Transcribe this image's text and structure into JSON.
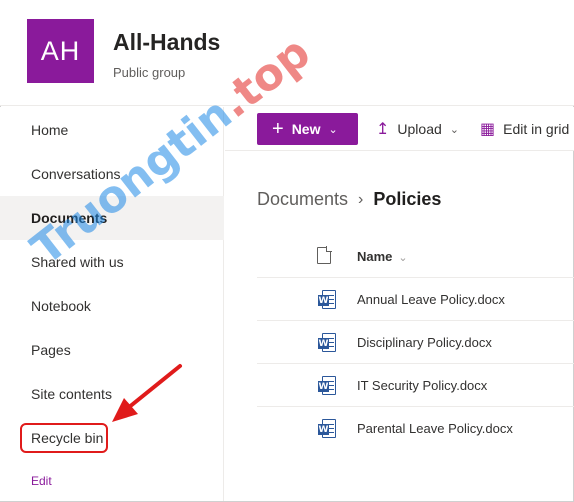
{
  "site": {
    "logo_initials": "AH",
    "title": "All-Hands",
    "subtitle": "Public group"
  },
  "nav": {
    "items": [
      {
        "label": "Home"
      },
      {
        "label": "Conversations"
      },
      {
        "label": "Documents",
        "selected": true
      },
      {
        "label": "Shared with us"
      },
      {
        "label": "Notebook"
      },
      {
        "label": "Pages"
      },
      {
        "label": "Site contents"
      },
      {
        "label": "Recycle bin",
        "highlighted": true
      }
    ],
    "edit_label": "Edit"
  },
  "commandbar": {
    "new_label": "New",
    "upload_label": "Upload",
    "edit_grid_label": "Edit in grid"
  },
  "breadcrumb": {
    "parent": "Documents",
    "current": "Policies"
  },
  "list": {
    "column_name": "Name",
    "rows": [
      {
        "name": "Annual Leave Policy.docx"
      },
      {
        "name": "Disciplinary Policy.docx"
      },
      {
        "name": "IT Security Policy.docx"
      },
      {
        "name": "Parental Leave Policy.docx"
      }
    ]
  },
  "watermark": {
    "brand": "Truongtin",
    "tld": ".top"
  },
  "colors": {
    "accent": "#8a1a9b",
    "word_blue": "#2b579a",
    "highlight_red": "#e01b1b"
  }
}
